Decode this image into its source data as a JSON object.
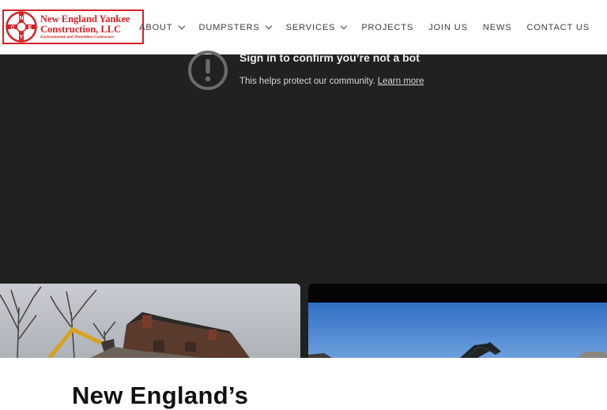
{
  "brand": {
    "logo_line1": "New England Yankee",
    "logo_line2": "Construction, LLC",
    "logo_line3": "Environmental and Demolition Contractors",
    "emblem_letters": [
      "N",
      "E",
      "Y",
      "C"
    ],
    "color": "#d62128"
  },
  "nav": {
    "items": [
      {
        "label": "ABOUT",
        "has_dropdown": true
      },
      {
        "label": "DUMPSTERS",
        "has_dropdown": true
      },
      {
        "label": "SERVICES",
        "has_dropdown": true
      },
      {
        "label": "PROJECTS",
        "has_dropdown": false
      },
      {
        "label": "JOIN US",
        "has_dropdown": false
      },
      {
        "label": "NEWS",
        "has_dropdown": false
      },
      {
        "label": "CONTACT US",
        "has_dropdown": false
      }
    ]
  },
  "video": {
    "title": "Sign in to confirm you’re not a bot",
    "subtitle": "This helps protect our community.",
    "learn_more": "Learn more",
    "icon": "alert-circle-icon",
    "background": "#212121"
  },
  "cards": [
    {
      "image": "demolition-house-photo"
    },
    {
      "image": "excavator-blue-sky-photo"
    }
  ],
  "section": {
    "headline": "New England’s"
  }
}
